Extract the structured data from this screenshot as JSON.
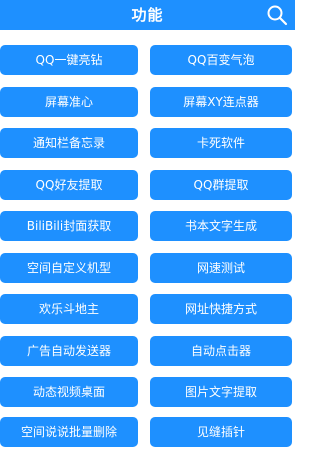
{
  "header": {
    "title": "功能",
    "search_icon": "search-icon",
    "bg_color": "#1e90ff"
  },
  "buttons": [
    [
      "QQ一键亮钻",
      "QQ百变气泡"
    ],
    [
      "屏幕准心",
      "屏幕XY连点器"
    ],
    [
      "通知栏备忘录",
      "卡死软件"
    ],
    [
      "QQ好友提取",
      "QQ群提取"
    ],
    [
      "BiliBili封面获取",
      "书本文字生成"
    ],
    [
      "空间自定义机型",
      "网速测试"
    ],
    [
      "欢乐斗地主",
      "网址快捷方式"
    ],
    [
      "广告自动发送器",
      "自动点击器"
    ],
    [
      "动态视频桌面",
      "图片文字提取"
    ],
    [
      "空间说说批量删除",
      "见缝插针"
    ]
  ]
}
